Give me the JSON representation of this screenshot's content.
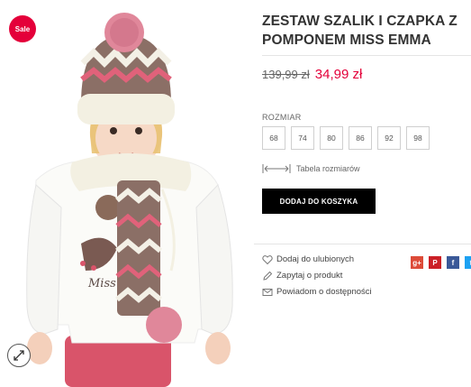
{
  "badge": {
    "label": "Sale",
    "color": "#e4003a"
  },
  "product": {
    "title": "ZESTAW SZALIK I CZAPKA Z POMPONEM MISS EMMA",
    "old_price": "139,99 zł",
    "new_price": "34,99 zł",
    "size_label": "ROZMIAR",
    "sizes": [
      "68",
      "74",
      "80",
      "86",
      "92",
      "98"
    ],
    "size_table_label": "Tabela rozmiarów",
    "add_to_cart": "DODAJ DO KOSZYKA"
  },
  "actions": {
    "favorite": "Dodaj do ulubionych",
    "ask": "Zapytaj o produkt",
    "notify": "Powiadom o dostępności"
  },
  "social": [
    {
      "icon": "google-plus-icon",
      "glyph": "g+",
      "color": "#dd4b39"
    },
    {
      "icon": "pinterest-icon",
      "glyph": "P",
      "color": "#cb2027"
    },
    {
      "icon": "facebook-icon",
      "glyph": "f",
      "color": "#3b5998"
    },
    {
      "icon": "twitter-icon",
      "glyph": "t",
      "color": "#1da1f2"
    }
  ],
  "icons": {
    "zoom": "expand-arrows-icon",
    "size_table": "ruler-arrows-icon"
  }
}
